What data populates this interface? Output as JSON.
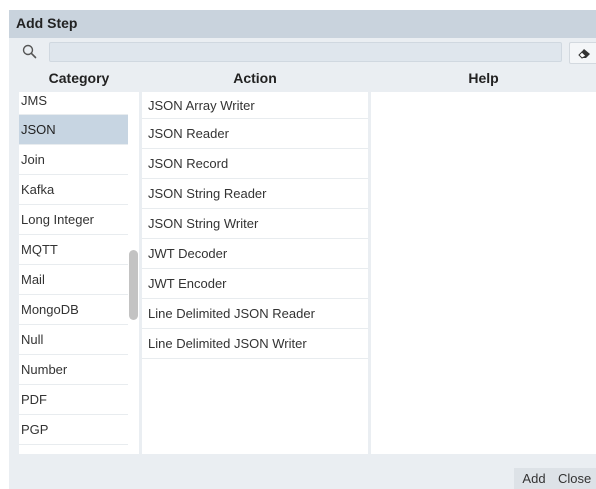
{
  "dialog": {
    "title": "Add Step"
  },
  "search": {
    "value": "",
    "placeholder": ""
  },
  "columns": {
    "category": "Category",
    "action": "Action",
    "help": "Help"
  },
  "categories": {
    "items": [
      "JMS",
      "JSON",
      "Join",
      "Kafka",
      "Long Integer",
      "MQTT",
      "Mail",
      "MongoDB",
      "Null",
      "Number",
      "PDF",
      "PGP"
    ],
    "selected": "JSON"
  },
  "actions": {
    "items": [
      "JSON Array Writer",
      "JSON Reader",
      "JSON Record",
      "JSON String Reader",
      "JSON String Writer",
      "JWT Decoder",
      "JWT Encoder",
      "Line Delimited JSON Reader",
      "Line Delimited JSON Writer"
    ]
  },
  "help": {
    "text": ""
  },
  "footer": {
    "add_label": "Add",
    "close_label": "Close"
  },
  "icons": {
    "search": "search-icon",
    "clear": "eraser-icon"
  },
  "colors": {
    "titlebar": "#c9d3dd",
    "selected_row": "#c7d5e2",
    "background": "#eaeef2"
  }
}
